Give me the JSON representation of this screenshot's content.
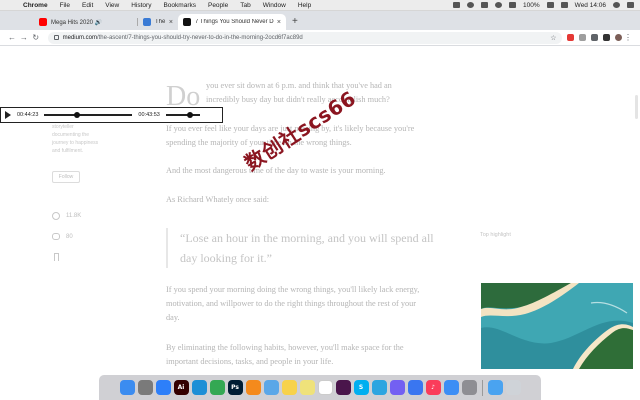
{
  "menubar": {
    "items": [
      "Chrome",
      "File",
      "Edit",
      "View",
      "History",
      "Bookmarks",
      "People",
      "Tab",
      "Window",
      "Help"
    ],
    "battery": "100%",
    "clock": "Wed 14:06"
  },
  "tabs": [
    {
      "label": "Mega Hits 2020 🔊",
      "favicon_color": "#ff0000"
    },
    {
      "label": "The Be",
      "favicon_color": "#3a7bd5"
    },
    {
      "label": "7 Things You Should Never Do",
      "favicon_color": "#111111"
    }
  ],
  "address_bar": {
    "domain": "medium.com",
    "path": "/the-ascent/7-things-you-should-try-never-to-do-in-the-morning-2ocd6f7ac89d"
  },
  "sidebar": {
    "bio_lines": [
      "...",
      "storyteller",
      "documenting the",
      "journey to happiness",
      "and fulfilment."
    ],
    "follow_label": "Follow",
    "claps": "11.8K",
    "responses": "80"
  },
  "player": {
    "current_time": "00:44:23",
    "duration": "00:43:53",
    "progress": 0.37,
    "volume": 0.7
  },
  "article": {
    "dropcap": "Do",
    "para1_line1": "you ever sit down at 6 p.m. and think that you've had an",
    "para1_line2": "incredibly busy day but didn't really accomplish much?",
    "para2_line1": "If you ever feel like your days are just passing by, it's likely because you're",
    "para2_line2": "spending the majority of your time on the wrong things.",
    "para3": "And the most dangerous time of the day to waste is your morning.",
    "para4": "As Richard Whately once said:",
    "quote_line1": "“Lose an hour in the morning, and you will spend all",
    "quote_line2": "day looking for it.”",
    "highlight_label": "Top highlight",
    "para5_line1": "If you spend your morning doing the wrong things, you'll likely lack energy,",
    "para5_line2": "motivation, and willpower to do the right things throughout the rest of your",
    "para5_line3": "day.",
    "para6_line1": "By eliminating the following habits, however, you'll make space for the",
    "para6_line2": "important decisions, tasks, and people in your life."
  },
  "watermark": "数创社scs66",
  "dock": {
    "apps": [
      {
        "name": "finder",
        "color": "#3b8cf0",
        "glyph": ""
      },
      {
        "name": "launchpad",
        "color": "#7a7a7a",
        "glyph": ""
      },
      {
        "name": "safari",
        "color": "#2d7ff9",
        "glyph": ""
      },
      {
        "name": "illustrator",
        "color": "#330000",
        "glyph": "Ai"
      },
      {
        "name": "edge",
        "color": "#1c8fd6",
        "glyph": ""
      },
      {
        "name": "chrome",
        "color": "#34a853",
        "glyph": ""
      },
      {
        "name": "photoshop",
        "color": "#001d34",
        "glyph": "Ps"
      },
      {
        "name": "vlc",
        "color": "#f48a1c",
        "glyph": ""
      },
      {
        "name": "preview",
        "color": "#5aa7e8",
        "glyph": ""
      },
      {
        "name": "notes",
        "color": "#f7d24b",
        "glyph": ""
      },
      {
        "name": "stickies",
        "color": "#efe27a",
        "glyph": ""
      },
      {
        "name": "calendar",
        "color": "#ffffff",
        "glyph": ""
      },
      {
        "name": "slack",
        "color": "#4a154b",
        "glyph": ""
      },
      {
        "name": "skype",
        "color": "#00aff0",
        "glyph": "S"
      },
      {
        "name": "telegram",
        "color": "#2ca5e0",
        "glyph": ""
      },
      {
        "name": "viber",
        "color": "#7360f2",
        "glyph": ""
      },
      {
        "name": "signal",
        "color": "#3a76f0",
        "glyph": ""
      },
      {
        "name": "music",
        "color": "#fa3c5a",
        "glyph": "♪"
      },
      {
        "name": "mail",
        "color": "#3c8ef5",
        "glyph": ""
      },
      {
        "name": "system-preferences",
        "color": "#8e8e93",
        "glyph": ""
      },
      {
        "name": "downloads",
        "color": "#4aa3f0",
        "glyph": ""
      },
      {
        "name": "trash",
        "color": "#cfd3d8",
        "glyph": ""
      }
    ]
  }
}
